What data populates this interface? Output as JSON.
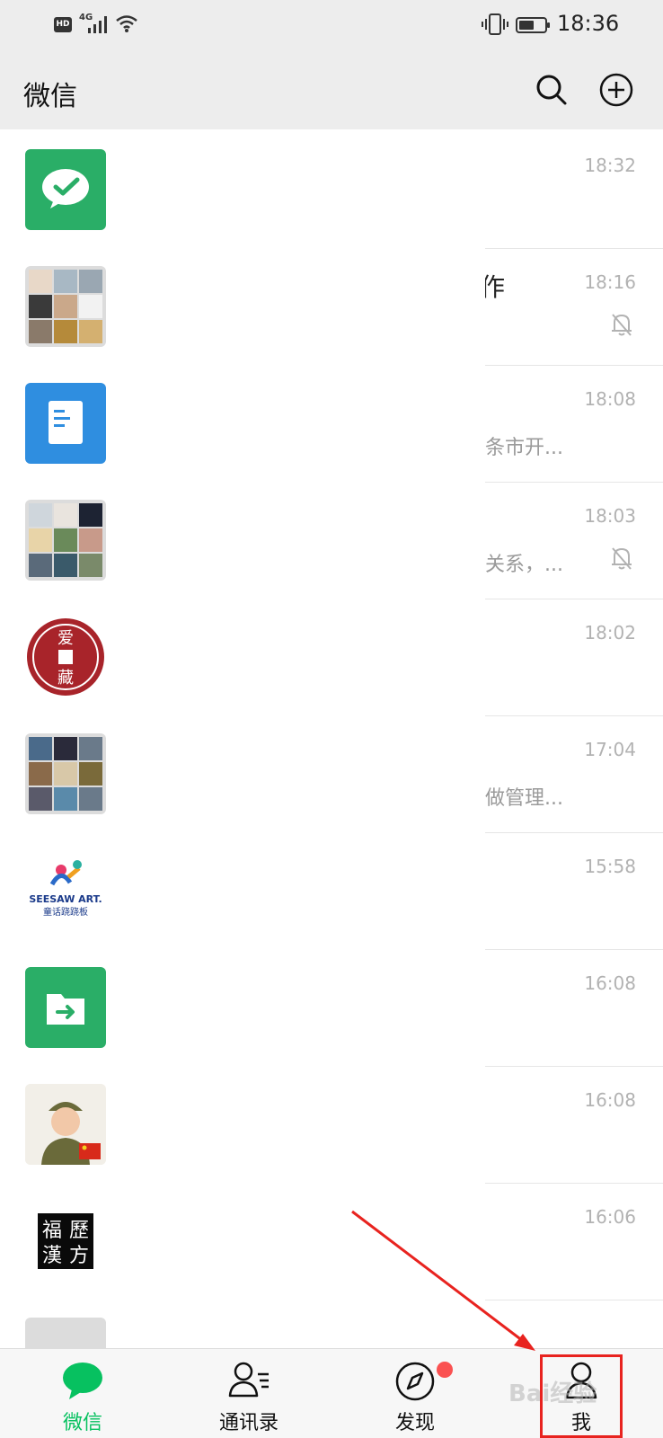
{
  "status_bar": {
    "hd": "HD",
    "network": "4G",
    "time": "18:36",
    "icons": [
      "signal-icon",
      "wifi-icon",
      "vibrate-icon",
      "battery-icon"
    ]
  },
  "header": {
    "title": "微信",
    "icons": [
      "search-icon",
      "plus-circle-icon"
    ]
  },
  "chats": [
    {
      "avatar": "wechat-green-icon",
      "time": "18:32",
      "title_fragment": "",
      "preview": "",
      "muted": false
    },
    {
      "avatar": "group-collage",
      "time": "18:16",
      "title_fragment": "作",
      "preview": "",
      "muted": true
    },
    {
      "avatar": "document-blue-icon",
      "time": "18:08",
      "title_fragment": "",
      "preview": "条市开...",
      "muted": false
    },
    {
      "avatar": "group-collage",
      "time": "18:03",
      "title_fragment": "",
      "preview": "关系，...",
      "muted": true
    },
    {
      "avatar": "red-seal-logo",
      "time": "18:02",
      "title_fragment": "",
      "preview": "",
      "muted": false
    },
    {
      "avatar": "group-collage",
      "time": "17:04",
      "title_fragment": "",
      "preview": "做管理...",
      "muted": false
    },
    {
      "avatar": "seesaw-art-logo",
      "time": "15:58",
      "title_fragment": "",
      "preview": "",
      "muted": false
    },
    {
      "avatar": "file-transfer-icon",
      "time": "16:08",
      "title_fragment": "",
      "preview": "",
      "muted": false
    },
    {
      "avatar": "child-photo",
      "time": "16:08",
      "title_fragment": "",
      "preview": "",
      "muted": false
    },
    {
      "avatar": "calligraphy-logo",
      "time": "16:06",
      "title_fragment": "",
      "preview": "",
      "muted": false
    }
  ],
  "logos": {
    "seesaw": "SEESAW ART.",
    "seesaw_cn": "童话跷跷板",
    "calligraphy": [
      "福",
      "歷",
      "漢",
      "方"
    ],
    "seal": "爱 藏"
  },
  "tabs": [
    {
      "label": "微信",
      "icon": "chat-bubble-icon",
      "active": true,
      "badge": false
    },
    {
      "label": "通讯录",
      "icon": "contacts-icon",
      "active": false,
      "badge": false
    },
    {
      "label": "发现",
      "icon": "compass-icon",
      "active": false,
      "badge": true
    },
    {
      "label": "我",
      "icon": "person-icon",
      "active": false,
      "badge": false
    }
  ],
  "colors": {
    "brand_green": "#07c160",
    "header_bg": "#ededed",
    "badge_red": "#fa5151",
    "annotation_red": "#e8231f"
  },
  "watermark": "Bai经验"
}
